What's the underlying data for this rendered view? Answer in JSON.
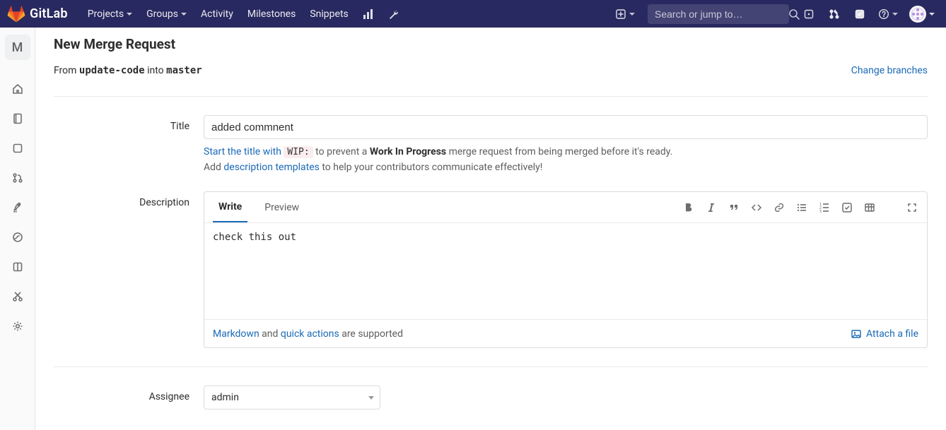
{
  "brand": {
    "name": "GitLab"
  },
  "nav": {
    "projects": "Projects",
    "groups": "Groups",
    "activity": "Activity",
    "milestones": "Milestones",
    "snippets": "Snippets"
  },
  "search": {
    "placeholder": "Search or jump to…"
  },
  "sidebar": {
    "project_letter": "M"
  },
  "page": {
    "title": "New Merge Request",
    "from_label": "From ",
    "from_branch": "update-code",
    "into_label": " into ",
    "into_branch": "master",
    "change_branches": "Change branches"
  },
  "fields": {
    "title_label": "Title",
    "title_value": "added commnent",
    "wip_helper_a": "Start the title with ",
    "wip_chip": "WIP:",
    "wip_helper_b": " to prevent a ",
    "wip_helper_strong": "Work In Progress",
    "wip_helper_c": " merge request from being merged before it's ready.",
    "desc_templates_a": "Add ",
    "desc_templates_link": "description templates",
    "desc_templates_b": " to help your contributors communicate effectively!",
    "description_label": "Description"
  },
  "editor": {
    "tab_write": "Write",
    "tab_preview": "Preview",
    "body": "check this out",
    "markdown_link": "Markdown",
    "quick_actions_link": "quick actions",
    "footer_and": " and ",
    "footer_supported": " are supported",
    "attach_label": "Attach a file"
  },
  "assignee": {
    "label": "Assignee",
    "value": "admin"
  }
}
